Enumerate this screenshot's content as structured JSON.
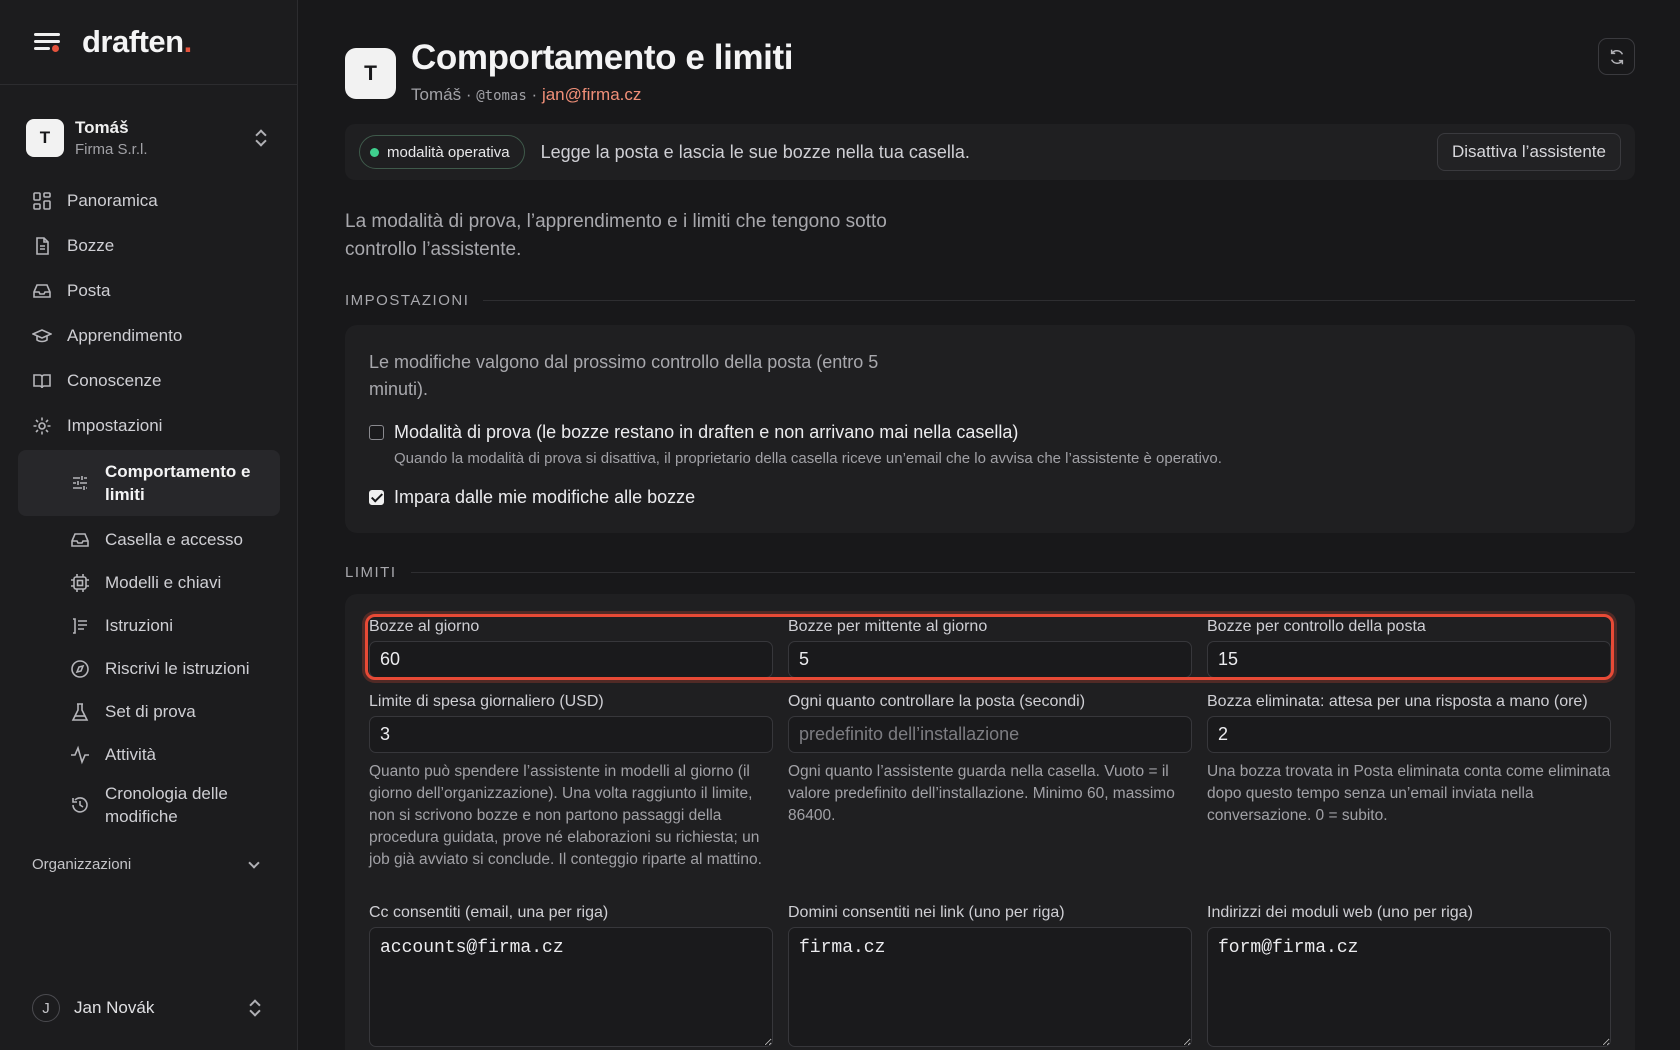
{
  "brand": {
    "name": "draften",
    "dot": "."
  },
  "account": {
    "initial": "T",
    "name": "Tomáš",
    "org": "Firma S.r.l."
  },
  "nav": {
    "items": [
      {
        "label": "Panoramica",
        "icon": "grid-icon"
      },
      {
        "label": "Bozze",
        "icon": "document-icon"
      },
      {
        "label": "Posta",
        "icon": "inbox-icon"
      },
      {
        "label": "Apprendimento",
        "icon": "graduation-cap-icon"
      },
      {
        "label": "Conoscenze",
        "icon": "book-icon"
      },
      {
        "label": "Impostazioni",
        "icon": "gear-icon"
      }
    ],
    "sub": [
      {
        "label": "Comportamento e limiti",
        "icon": "sliders-icon"
      },
      {
        "label": "Casella e accesso",
        "icon": "inbox-icon"
      },
      {
        "label": "Modelli e chiavi",
        "icon": "chip-icon"
      },
      {
        "label": "Istruzioni",
        "icon": "list-icon"
      },
      {
        "label": "Riscrivi le istruzioni",
        "icon": "compass-icon"
      },
      {
        "label": "Set di prova",
        "icon": "flask-icon"
      },
      {
        "label": "Attività",
        "icon": "activity-icon"
      },
      {
        "label": "Cronologia delle modifiche",
        "icon": "history-icon"
      }
    ],
    "organizations": "Organizzazioni"
  },
  "user": {
    "initial": "J",
    "name": "Jan Novák"
  },
  "header": {
    "initial": "T",
    "title": "Comportamento e limiti",
    "name": "Tomáš",
    "sep": "·",
    "handle": "@tomas",
    "email": "jan@firma.cz"
  },
  "status": {
    "badge": "modalità operativa",
    "message": "Legge la posta e lascia le sue bozze nella tua casella.",
    "button": "Disattiva l’assistente",
    "accent": "#3fcf8e"
  },
  "intro": "La modalità di prova, l’apprendimento e i limiti che tengono sotto controllo l’assistente.",
  "settings": {
    "heading": "IMPOSTAZIONI",
    "note": "Le modifiche valgono dal prossimo controllo della posta (entro 5 minuti).",
    "trial": {
      "label": "Modalità di prova (le bozze restano in draften e non arrivano mai nella casella)",
      "help": "Quando la modalità di prova si disattiva, il proprietario della casella riceve un’email che lo avvisa che l’assistente è operativo.",
      "checked": false
    },
    "learn": {
      "label": "Impara dalle mie modifiche alle bozze",
      "checked": true
    }
  },
  "limits": {
    "heading": "LIMITI",
    "highlight_color": "#e84a36",
    "drafts_per_day": {
      "label": "Bozze al giorno",
      "value": "60"
    },
    "drafts_per_sender": {
      "label": "Bozze per mittente al giorno",
      "value": "5"
    },
    "drafts_per_check": {
      "label": "Bozze per controllo della posta",
      "value": "15"
    },
    "spend_limit": {
      "label": "Limite di spesa giornaliero (USD)",
      "value": "3",
      "help": "Quanto può spendere l’assistente in modelli al giorno (il giorno dell’organizzazione). Una volta raggiunto il limite, non si scrivono bozze e non partono passaggi della procedura guidata, prove né elaborazioni su richiesta; un job già avviato si conclude. Il conteggio riparte al mattino."
    },
    "poll_interval": {
      "label": "Ogni quanto controllare la posta (secondi)",
      "value": "",
      "placeholder": "predefinito dell’installazione",
      "help": "Ogni quanto l’assistente guarda nella casella. Vuoto = il valore predefinito dell’installazione. Minimo 60, massimo 86400."
    },
    "deleted_wait": {
      "label": "Bozza eliminata: attesa per una risposta a mano (ore)",
      "value": "2",
      "help": "Una bozza trovata in Posta eliminata conta come eliminata dopo questo tempo senza un’email inviata nella conversazione. 0 = subito."
    },
    "cc_allowed": {
      "label": "Cc consentiti (email, una per riga)",
      "value": "accounts@firma.cz"
    },
    "link_domains": {
      "label": "Domini consentiti nei link (uno per riga)",
      "value": "firma.cz"
    },
    "form_addresses": {
      "label": "Indirizzi dei moduli web (uno per riga)",
      "value": "form@firma.cz"
    }
  }
}
